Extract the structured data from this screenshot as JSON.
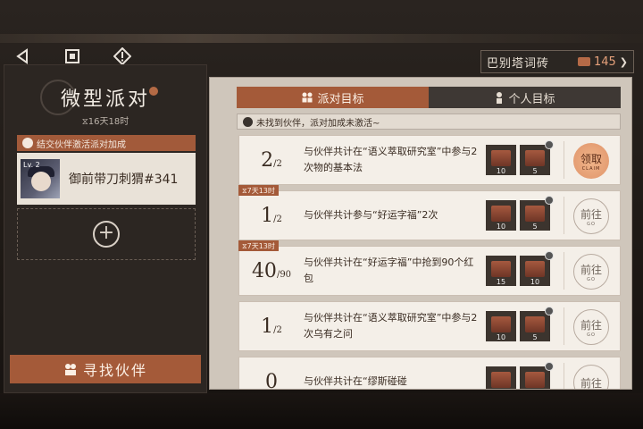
{
  "nav": {
    "back_icon": "triangle-left-icon",
    "home_icon": "square-icon",
    "info_icon": "exclamation-diamond-icon"
  },
  "currency": {
    "label": "巴别塔词砖",
    "value": "145",
    "icon": "brick-icon"
  },
  "left": {
    "title": "微型派对",
    "time": "⧖16天18时",
    "bar_text": "结交伙伴激活派对加成",
    "partner": {
      "level": "Lv. 2",
      "name": "御前带刀刺猬#341"
    },
    "find_label": "寻找伙伴"
  },
  "tabs": [
    {
      "label": "派对目标",
      "active": true
    },
    {
      "label": "个人目标",
      "active": false
    }
  ],
  "warning": "未找到伙伴，派对加成未激活~",
  "tasks": [
    {
      "progress": "2",
      "total": "2",
      "desc": "与伙伴共计在“语义萃取研究室”中参与2次物的基本法",
      "rewards": [
        "10",
        "5"
      ],
      "action": "领取",
      "action_sub": "CLAIM",
      "claimable": true,
      "tag": ""
    },
    {
      "progress": "1",
      "total": "2",
      "desc": "与伙伴共计参与“好运字福”2次",
      "rewards": [
        "10",
        "5"
      ],
      "action": "前往",
      "action_sub": "GO",
      "claimable": false,
      "tag": "⧖7天13时"
    },
    {
      "progress": "40",
      "total": "90",
      "desc": "与伙伴共计在“好运字福”中抢到90个红包",
      "rewards": [
        "15",
        "10"
      ],
      "action": "前往",
      "action_sub": "GO",
      "claimable": false,
      "tag": "⧖7天13时"
    },
    {
      "progress": "1",
      "total": "2",
      "desc": "与伙伴共计在“语义萃取研究室”中参与2次乌有之问",
      "rewards": [
        "10",
        "5"
      ],
      "action": "前往",
      "action_sub": "GO",
      "claimable": false,
      "tag": ""
    },
    {
      "progress": "0",
      "total": "",
      "desc": "与伙伴共计在“缪斯碰碰",
      "rewards": [
        "",
        ""
      ],
      "action": "前往",
      "action_sub": "",
      "claimable": false,
      "tag": ""
    }
  ]
}
